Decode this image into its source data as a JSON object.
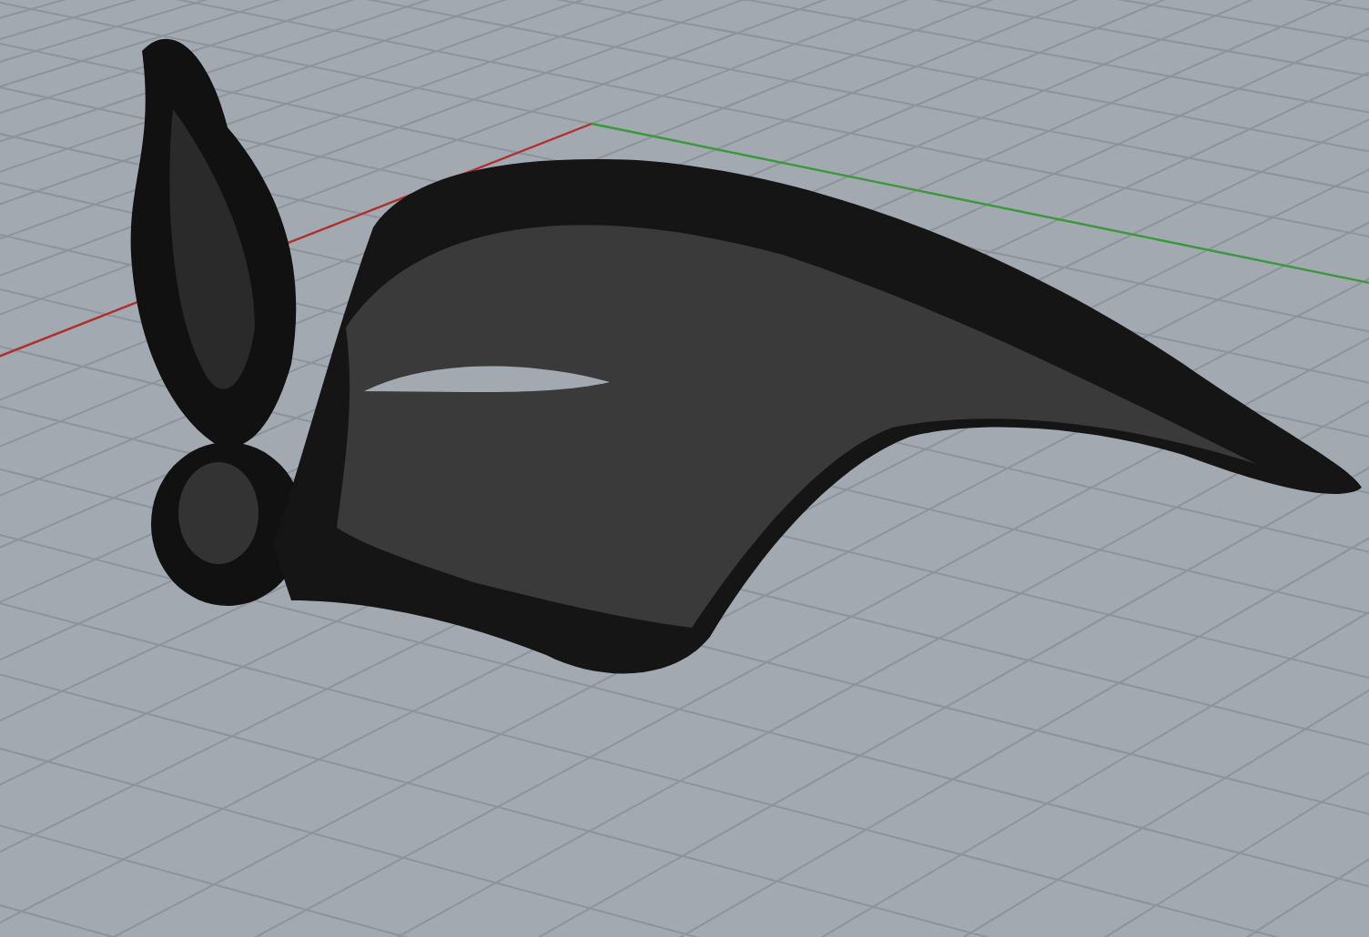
{
  "viewport": {
    "kind": "perspective",
    "show_grid": true,
    "show_axes": true
  }
}
